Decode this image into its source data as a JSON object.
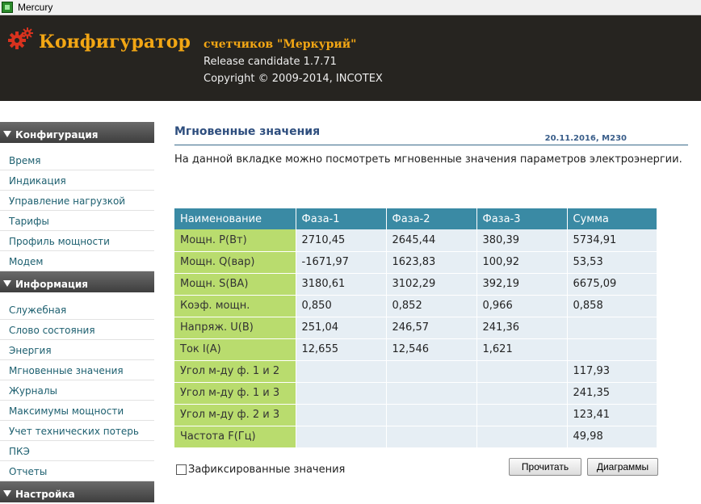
{
  "window": {
    "title": "Mercury",
    "icon": "app-icon"
  },
  "header": {
    "title": "Конфигуратор",
    "subtitle": "счетчиков \"Меркурий\"",
    "release": "Release candidate 1.7.71",
    "copyright": "Copyright © 2009-2014, INCOTEX",
    "logo_icon": "gear-icon",
    "colors": {
      "background": "#262420",
      "accent": "#f2a614"
    }
  },
  "sidebar": {
    "sections": [
      {
        "title": "Конфигурация",
        "items": [
          "Время",
          "Индикация",
          "Управление нагрузкой",
          "Тарифы",
          "Профиль мощности",
          "Модем"
        ]
      },
      {
        "title": "Информация",
        "items": [
          "Служебная",
          "Слово состояния",
          "Энергия",
          "Мгновенные значения",
          "Журналы",
          "Максимумы мощности",
          "Учет технических потерь",
          "ПКЭ",
          "Отчеты"
        ]
      },
      {
        "title": "Настройка",
        "items": []
      }
    ]
  },
  "main": {
    "title": "Мгновенные значения",
    "meta": "20.11.2016, M230",
    "description": "На данной вкладке можно посмотреть мгновенные значения параметров электроэнергии.",
    "table": {
      "headers": [
        "Наименование",
        "Фаза-1",
        "Фаза-2",
        "Фаза-3",
        "Сумма"
      ],
      "rows": [
        [
          "Мощн. P(Вт)",
          "2710,45",
          "2645,44",
          "380,39",
          "5734,91"
        ],
        [
          "Мощн. Q(вар)",
          "-1671,97",
          "1623,83",
          "100,92",
          "53,53"
        ],
        [
          "Мощн. S(ВА)",
          "3180,61",
          "3102,29",
          "392,19",
          "6675,09"
        ],
        [
          "Коэф. мощн.",
          "0,850",
          "0,852",
          "0,966",
          "0,858"
        ],
        [
          "Напряж. U(В)",
          "251,04",
          "246,57",
          "241,36",
          ""
        ],
        [
          "Ток I(А)",
          "12,655",
          "12,546",
          "1,621",
          ""
        ],
        [
          "Угол м-ду ф. 1 и 2",
          "",
          "",
          "",
          "117,93"
        ],
        [
          "Угол м-ду ф. 1 и 3",
          "",
          "",
          "",
          "241,35"
        ],
        [
          "Угол м-ду ф. 2 и 3",
          "",
          "",
          "",
          "123,41"
        ],
        [
          "Частота F(Гц)",
          "",
          "",
          "",
          "49,98"
        ]
      ]
    },
    "fixed_values_label": "Зафиксированные значения",
    "fixed_values_checked": false,
    "read_button": "Прочитать",
    "charts_button": "Диаграммы"
  }
}
